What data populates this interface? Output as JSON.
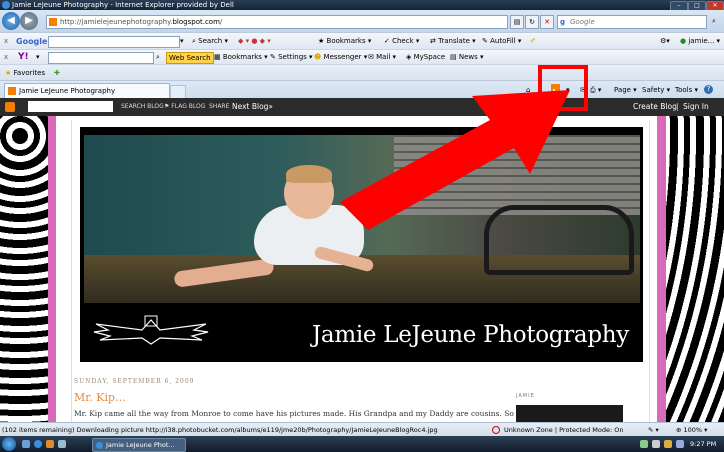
{
  "window": {
    "title": "Jamie LeJeune Photography - Internet Explorer provided by Dell",
    "minimize": "–",
    "maximize": "□",
    "close": "✕"
  },
  "address_bar": {
    "url_prefix": "http://jamielejeunephotography.",
    "url_domain": "blogspot.com",
    "url_suffix": "/",
    "search_placeholder": "Google",
    "search_logo": "g"
  },
  "google_toolbar": {
    "close": "x",
    "logo": "Google",
    "search_label": "Search",
    "bookmarks_label": "Bookmarks",
    "check_label": "Check",
    "translate_label": "Translate",
    "autofill_label": "AutoFill",
    "user_label": "jamie..."
  },
  "yahoo_toolbar": {
    "close": "x",
    "logo": "Y!",
    "web_search_label": "Web Search",
    "bookmarks_label": "Bookmarks",
    "settings_label": "Settings",
    "messenger_label": "Messenger",
    "mail_label": "Mail",
    "myspace_label": "MySpace",
    "news_label": "News"
  },
  "favorites_bar": {
    "favorites_label": "Favorites"
  },
  "tab_bar": {
    "tab_label": "Jamie LeJeune Photography",
    "page_label": "Page",
    "safety_label": "Safety",
    "tools_label": "Tools",
    "help_label": "?"
  },
  "blogger_navbar": {
    "search_blog": "SEARCH BLOG",
    "flag_blog": "FLAG BLOG",
    "share": "SHARE",
    "next_blog": "Next Blog»",
    "create_blog": "Create Blog",
    "separator": "|",
    "sign_in": "Sign In"
  },
  "blog": {
    "title": "Jamie LeJeune Photography",
    "date_header": "SUNDAY, SEPTEMBER 6, 2009",
    "post_title": "Mr. Kip...",
    "post_body": "Mr. Kip came all the way from Monroe to come have his pictures made. His Grandpa and my Daddy are cousins. So I'm",
    "sidebar_label": "JAMIE"
  },
  "status_bar": {
    "message": "(102 items remaining) Downloading picture http://i38.photobucket.com/albums/e119/jme20b/Photography/JamieLeJeuneBlogRoc4.jpg",
    "zone": "Unknown Zone | Protected Mode: On",
    "zoom": "100%"
  },
  "taskbar": {
    "task_label": "Jamie LeJeune Phot...",
    "clock": "9:27 PM"
  },
  "colors": {
    "accent_red": "#ff0000",
    "rss_orange": "#f57d00",
    "frame_pink": "#d86ab8",
    "post_title_orange": "#e8893a"
  }
}
